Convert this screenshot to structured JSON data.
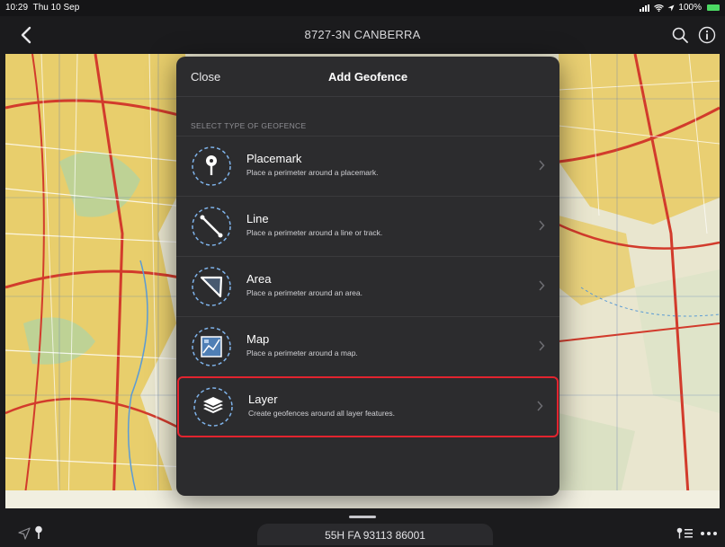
{
  "status": {
    "time": "10:29",
    "date": "Thu 10 Sep",
    "battery": "100%"
  },
  "nav": {
    "title": "8727-3N CANBERRA"
  },
  "modal": {
    "close_label": "Close",
    "title": "Add Geofence",
    "section_header": "SELECT TYPE OF GEOFENCE",
    "options": [
      {
        "title": "Placemark",
        "subtitle": "Place a perimeter around a placemark.",
        "icon": "placemark-icon"
      },
      {
        "title": "Line",
        "subtitle": "Place a perimeter around a line or track.",
        "icon": "line-icon"
      },
      {
        "title": "Area",
        "subtitle": "Place a perimeter around an area.",
        "icon": "area-icon"
      },
      {
        "title": "Map",
        "subtitle": "Place a perimeter around a map.",
        "icon": "map-icon"
      },
      {
        "title": "Layer",
        "subtitle": "Create geofences around all layer features.",
        "icon": "layer-icon",
        "selected": true
      }
    ]
  },
  "bottom": {
    "coordinates": "55H FA 93113 86001"
  },
  "colors": {
    "highlight": "#e2242f",
    "modal_bg": "#2c2c2e",
    "accent_blue": "#7fb3ea"
  }
}
